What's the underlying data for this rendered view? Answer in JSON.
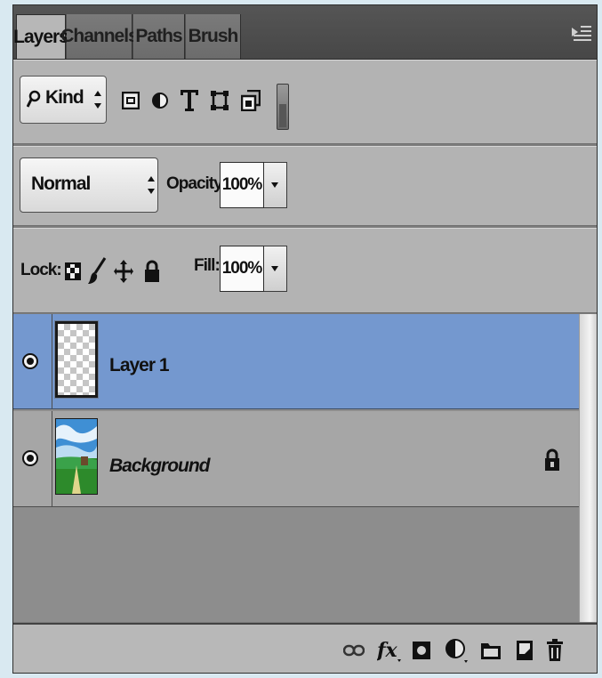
{
  "tabs": [
    {
      "label": "Layers",
      "active": true
    },
    {
      "label": "Channels",
      "active": false
    },
    {
      "label": "Paths",
      "active": false
    },
    {
      "label": "Brush",
      "active": false
    }
  ],
  "filter": {
    "kind_label": "Kind",
    "filter_icons": [
      "image-filter-icon",
      "adjustment-filter-icon",
      "type-filter-icon",
      "shape-filter-icon",
      "smart-object-filter-icon"
    ]
  },
  "blend": {
    "mode": "Normal",
    "opacity_label": "Opacity:",
    "opacity_value": "100%"
  },
  "lock": {
    "label": "Lock:",
    "icons": [
      "lock-transparent-icon",
      "lock-image-icon",
      "lock-position-icon",
      "lock-all-icon"
    ],
    "fill_label": "Fill:",
    "fill_value": "100%"
  },
  "layers": [
    {
      "name": "Layer 1",
      "selected": true,
      "visible": true,
      "locked": false
    },
    {
      "name": "Background",
      "selected": false,
      "visible": true,
      "locked": true
    }
  ],
  "bottom_icons": [
    "link-layers-icon",
    "fx-icon",
    "add-mask-icon",
    "adjustment-layer-icon",
    "new-group-icon",
    "new-layer-icon",
    "delete-icon"
  ],
  "colors": {
    "selected_layer": "#7498cf",
    "panel_bg": "#b3b3b3"
  }
}
